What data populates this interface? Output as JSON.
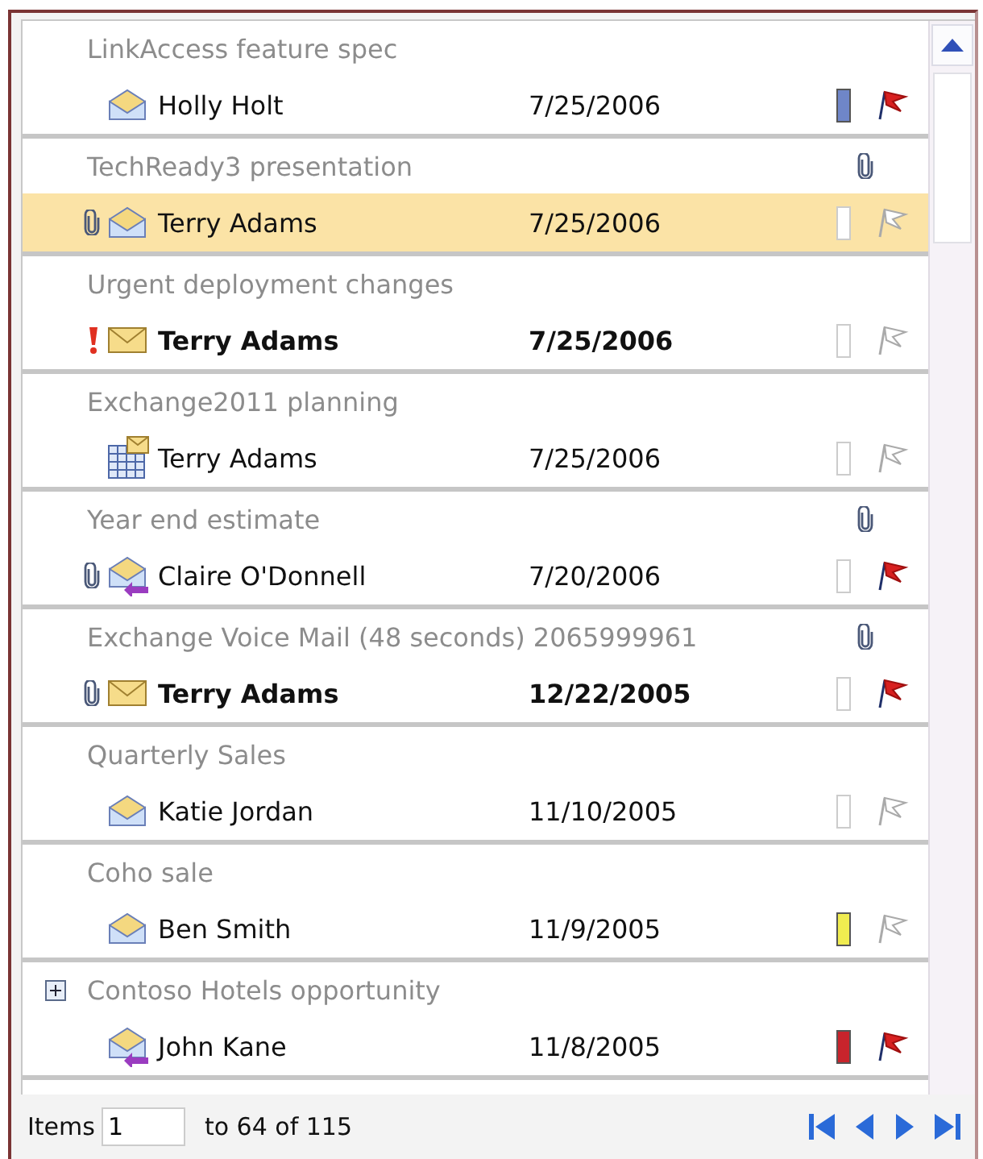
{
  "messages": [
    {
      "subject": "LinkAccess feature spec",
      "sender": "Holly Holt",
      "date": "7/25/2006",
      "kind": "read",
      "unread": false,
      "high_importance": false,
      "attachment": false,
      "color": "#6f86c8",
      "flagged": true,
      "selected": false
    },
    {
      "subject": "TechReady3 presentation",
      "sender": "Terry Adams",
      "date": "7/25/2006",
      "kind": "read",
      "unread": false,
      "high_importance": false,
      "attachment": true,
      "flagged": false,
      "selected": true
    },
    {
      "subject": "Urgent deployment changes",
      "sender": "Terry Adams",
      "date": "7/25/2006",
      "kind": "unread",
      "unread": true,
      "high_importance": true,
      "attachment": false,
      "flagged": false,
      "selected": false
    },
    {
      "subject": "Exchange2011 planning",
      "sender": "Terry Adams",
      "date": "7/25/2006",
      "kind": "meeting",
      "unread": false,
      "high_importance": false,
      "attachment": false,
      "flagged": false,
      "selected": false
    },
    {
      "subject": "Year end estimate",
      "sender": "Claire O'Donnell",
      "date": "7/20/2006",
      "kind": "replied",
      "unread": false,
      "high_importance": false,
      "attachment": true,
      "flagged": true,
      "selected": false
    },
    {
      "subject": "Exchange Voice Mail (48 seconds) 2065999961",
      "sender": "Terry Adams",
      "date": "12/22/2005",
      "kind": "unread",
      "unread": true,
      "high_importance": false,
      "attachment": true,
      "flagged": true,
      "selected": false
    },
    {
      "subject": "Quarterly Sales",
      "sender": "Katie Jordan",
      "date": "11/10/2005",
      "kind": "read",
      "unread": false,
      "high_importance": false,
      "attachment": false,
      "flagged": false,
      "selected": false
    },
    {
      "subject": "Coho sale",
      "sender": "Ben Smith",
      "date": "11/9/2005",
      "kind": "read",
      "unread": false,
      "high_importance": false,
      "attachment": false,
      "color": "#f0ec50",
      "flagged": false,
      "selected": false
    },
    {
      "subject": "Contoso Hotels opportunity",
      "sender": "John Kane",
      "date": "11/8/2005",
      "kind": "replied",
      "unread": false,
      "high_importance": false,
      "attachment": false,
      "color": "#c8242c",
      "flagged": true,
      "selected": false,
      "expandable": true,
      "expanded": false
    }
  ],
  "footer": {
    "items_label": "Items",
    "items_value": "1",
    "range_text": "to 64 of 115"
  }
}
